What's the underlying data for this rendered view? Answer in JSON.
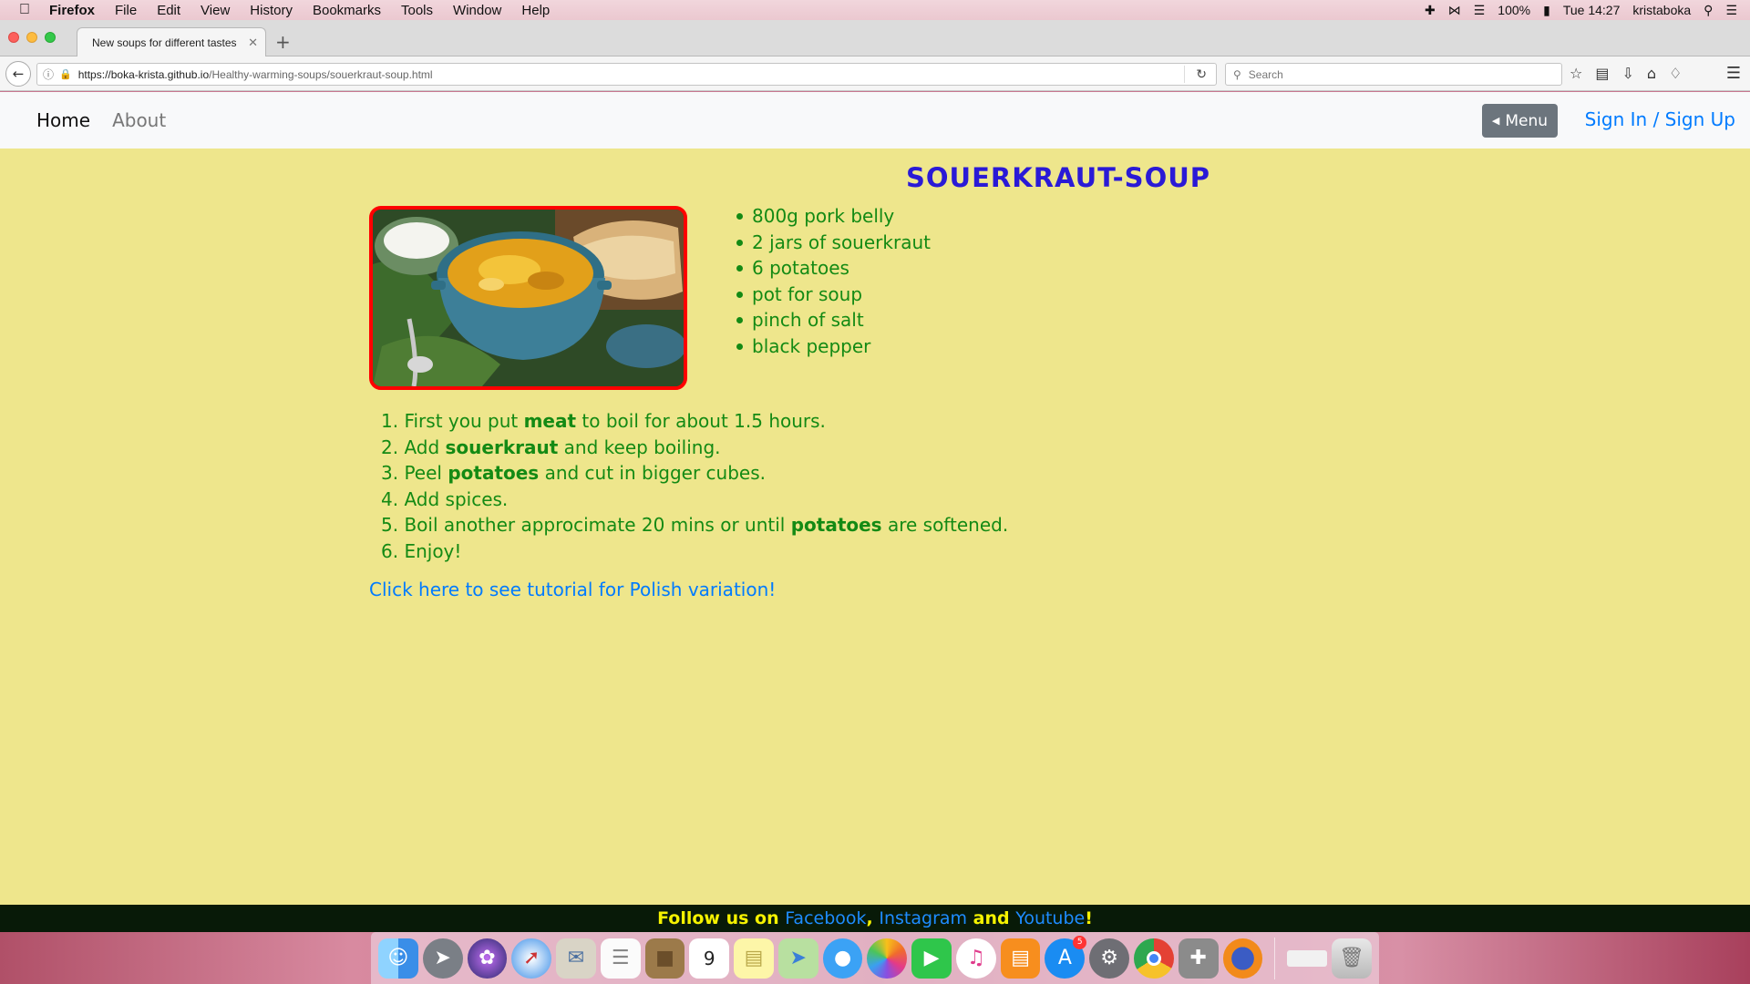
{
  "mac_menubar": {
    "app_name": "Firefox",
    "menus": [
      "File",
      "Edit",
      "View",
      "History",
      "Bookmarks",
      "Tools",
      "Window",
      "Help"
    ],
    "battery": "100%",
    "clock": "Tue 14:27",
    "user": "kristaboka"
  },
  "browser": {
    "tab_title": "New soups for different tastes",
    "url_domain": "https://boka-krista.github.io",
    "url_path": "/Healthy-warming-soups/souerkraut-soup.html",
    "search_placeholder": "Search"
  },
  "site_nav": {
    "home": "Home",
    "about": "About",
    "menu_button": "Menu",
    "signin": "Sign In / Sign Up"
  },
  "recipe": {
    "title": "SOUERKRAUT-SOUP",
    "ingredients": [
      "800g pork belly",
      "2 jars of souerkraut",
      "6 potatoes",
      "pot for soup",
      "pinch of salt",
      "black pepper"
    ],
    "steps": [
      {
        "num": "1.",
        "pre": "First you put ",
        "bold": "meat",
        "post": " to boil for about 1.5 hours."
      },
      {
        "num": "2.",
        "pre": "Add ",
        "bold": "souerkraut",
        "post": " and keep boiling."
      },
      {
        "num": "3.",
        "pre": "Peel ",
        "bold": "potatoes",
        "post": " and cut in bigger cubes."
      },
      {
        "num": "4.",
        "pre": "Add spices.",
        "bold": "",
        "post": ""
      },
      {
        "num": "5.",
        "pre": "Boil another approcimate 20 mins or until ",
        "bold": "potatoes",
        "post": " are softened."
      },
      {
        "num": "6.",
        "pre": "Enjoy!",
        "bold": "",
        "post": ""
      }
    ],
    "tutorial_link": "Click here to see tutorial for Polish variation!"
  },
  "footer": {
    "lead": "Follow us on ",
    "facebook": "Facebook",
    "comma": ", ",
    "instagram": "Instagram",
    "and": " and ",
    "youtube": "Youtube",
    "bang": "!"
  },
  "dock": {
    "calendar_day": "9",
    "appstore_badge": "5"
  }
}
